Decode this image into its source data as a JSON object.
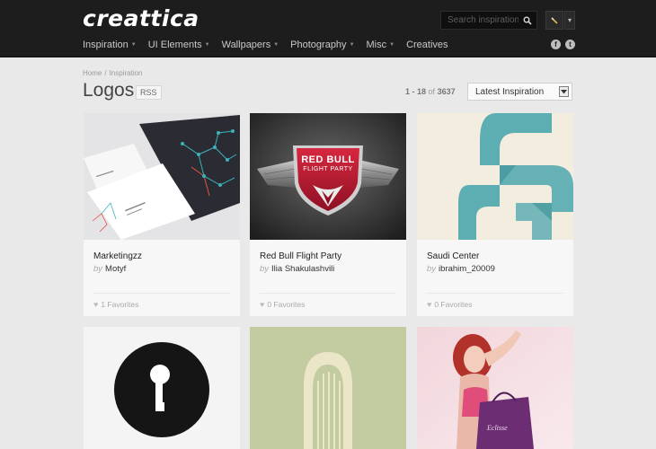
{
  "header": {
    "logo": "creattica",
    "search_placeholder": "Search inspiration",
    "nav": [
      "Inspiration",
      "UI Elements",
      "Wallpapers",
      "Photography",
      "Misc",
      "Creatives"
    ],
    "social": [
      "f",
      "t"
    ]
  },
  "breadcrumb": {
    "home": "Home",
    "sep": "/",
    "current": "Inspiration"
  },
  "page": {
    "title": "Logos",
    "rss": "RSS",
    "count_range": "1 - 18",
    "count_of": "of",
    "count_total": "3637",
    "sort": "Latest Inspiration"
  },
  "cards": [
    {
      "title": "Marketingzz",
      "by": "by",
      "author": "Motyf",
      "favorites": "1 Favorites"
    },
    {
      "title": "Red Bull Flight Party",
      "by": "by",
      "author": "Ilia Shakulashvili",
      "favorites": "0 Favorites",
      "logo_line1": "RED BULL",
      "logo_line2": "FLIGHT PARTY"
    },
    {
      "title": "Saudi Center",
      "by": "by",
      "author": "ibrahim_20009",
      "favorites": "0 Favorites"
    },
    {
      "bag_text": "Eclisse"
    }
  ],
  "colors": {
    "header_bg": "#1d1d1d",
    "page_bg": "#e9e9e9",
    "card_bg": "#f7f7f7",
    "teal_accent": "#4ca6ae",
    "redbull_red": "#c11d35"
  },
  "icons": [
    "search-icon",
    "user-icon",
    "facebook-icon",
    "twitter-icon",
    "heart-icon",
    "dropdown-arrow-icon"
  ]
}
